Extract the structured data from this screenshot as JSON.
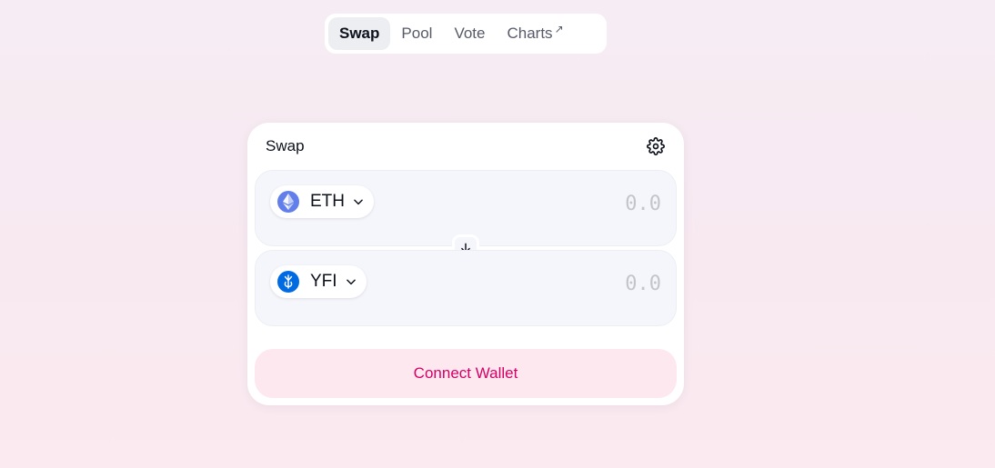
{
  "nav": {
    "tabs": [
      {
        "label": "Swap",
        "active": true
      },
      {
        "label": "Pool",
        "active": false
      },
      {
        "label": "Vote",
        "active": false
      },
      {
        "label": "Charts",
        "active": false,
        "external": true
      }
    ],
    "external_glyph": "↗"
  },
  "swap_card": {
    "title": "Swap",
    "settings_icon": "gear-icon",
    "input": {
      "token_symbol": "ETH",
      "token_icon": "ethereum-icon",
      "amount_placeholder": "0.0",
      "amount_value": ""
    },
    "switch_icon": "arrow-down-icon",
    "output": {
      "token_symbol": "YFI",
      "token_icon": "yfi-icon",
      "amount_placeholder": "0.0",
      "amount_value": ""
    },
    "connect_button_label": "Connect Wallet"
  },
  "colors": {
    "accent_pink": "#d50066",
    "connect_bg": "#fde8ef",
    "eth_blue": "#627eea",
    "yfi_blue": "#006ae3",
    "panel_bg": "#f5f6fc"
  }
}
